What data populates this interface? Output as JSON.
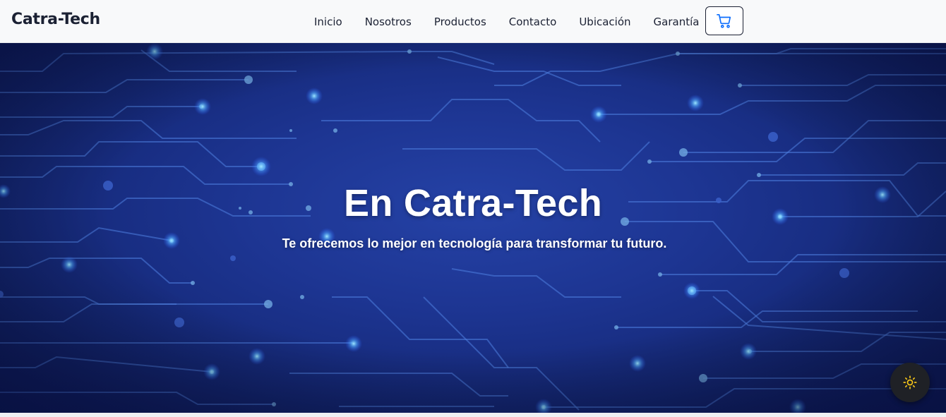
{
  "brand": {
    "name": "Catra-Tech"
  },
  "nav": {
    "links": [
      "Inicio",
      "Nosotros",
      "Productos",
      "Contacto",
      "Ubicación",
      "Garantía"
    ],
    "cart_icon": "cart-icon"
  },
  "hero": {
    "title": "En Catra-Tech",
    "subtitle": "Te ofrecemos lo mejor en tecnología para transformar tu futuro.",
    "background": "circuit-board"
  },
  "theme_toggle": {
    "icon": "sun-icon"
  },
  "colors": {
    "nav_bg": "#f8f9fa",
    "text_dark": "#1b2133",
    "cart_accent": "#0d6efd",
    "hero_blue": "#1d3592",
    "sun_yellow": "#f5c518"
  }
}
